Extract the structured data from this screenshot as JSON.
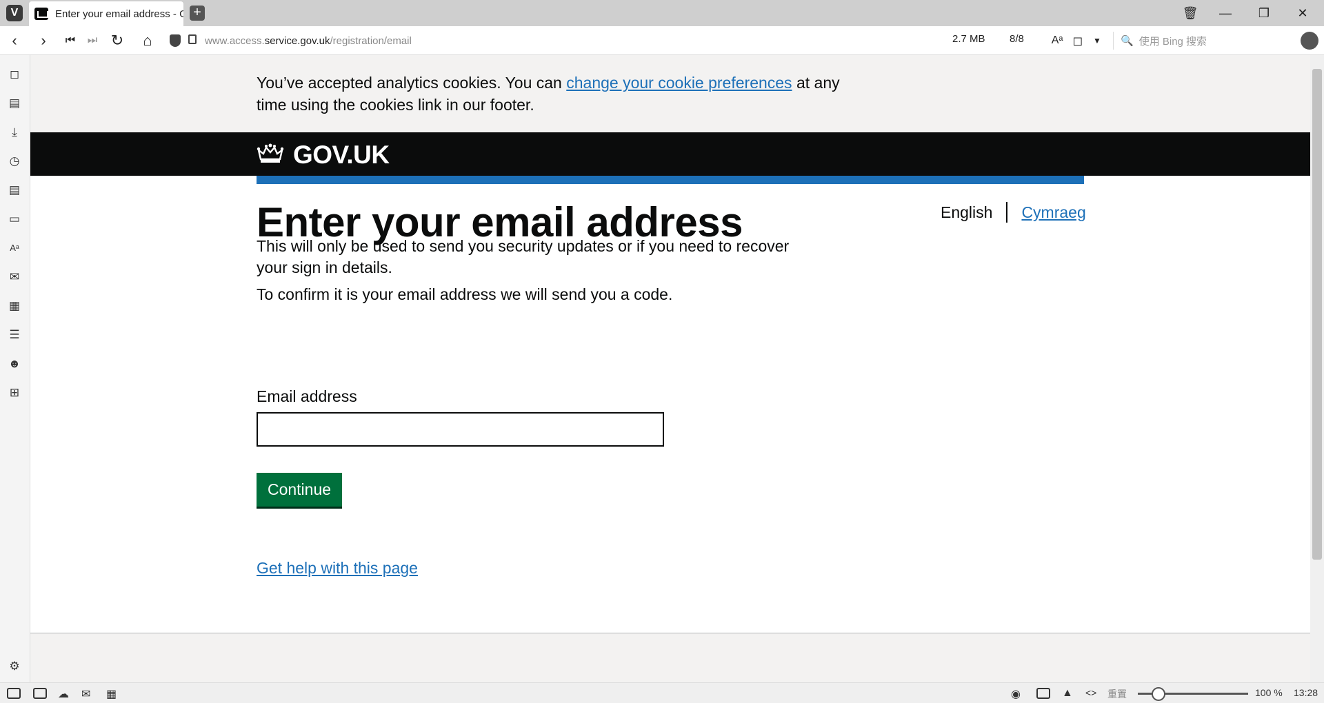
{
  "browser": {
    "tab_title": "Enter your email address - GOV.UK",
    "new_tab": "+",
    "url_prefix": "www.access.",
    "url_host": "service.gov.uk",
    "url_path": "/registration/email",
    "page_size": "2.7 MB",
    "resource_count": "8/8",
    "search_placeholder": "使用 Bing 搜索",
    "zoom_reset": "重置",
    "zoom_level": "100 %",
    "clock": "13:28"
  },
  "page": {
    "cookie_text_before": "You’ve accepted analytics cookies. You can ",
    "cookie_link": "change your cookie preferences",
    "cookie_text_after": " at any time using the cookies link in our footer.",
    "logo_text": "GOV.UK",
    "heading": "Enter your email address",
    "lang_current": "English",
    "lang_other": "Cymraeg",
    "para1": "This will only be used to send you security updates or if you need to recover your sign in details.",
    "para2": "To confirm it is your email address we will send you a code.",
    "email_label": "Email address",
    "email_value": "",
    "continue_label": "Continue",
    "help_link": "Get help with this page"
  },
  "colors": {
    "link": "#1d70b8",
    "header_bg": "#0b0c0c",
    "accent_bar": "#1d70b8",
    "button": "#00703c",
    "banner_bg": "#f3f2f1"
  },
  "icons": [
    "vivaldi-logo-icon",
    "back-icon",
    "forward-icon",
    "rewind-icon",
    "fast-forward-icon",
    "reload-icon",
    "home-icon",
    "shield-icon",
    "lock-icon",
    "translate-icon",
    "bookmark-icon",
    "search-icon",
    "profile-icon",
    "trash-icon",
    "minimize-icon",
    "maximize-icon",
    "close-icon"
  ]
}
